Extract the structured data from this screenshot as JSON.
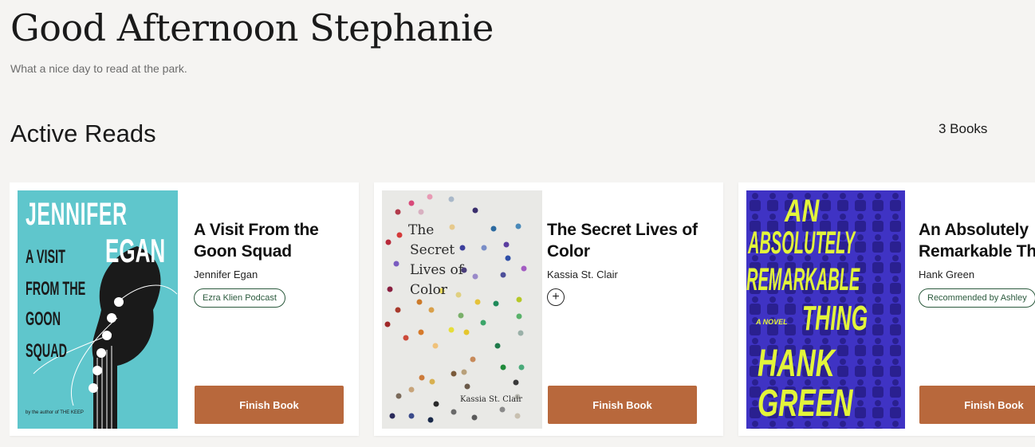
{
  "greeting": "Good Afternoon Stephanie",
  "subtitle": "What a nice day to read at the park.",
  "section": {
    "title": "Active Reads",
    "count": "3 Books"
  },
  "books": [
    {
      "title": "A Visit From the Goon Squad",
      "author": "Jennifer Egan",
      "tag": "Ezra Klien Podcast",
      "action": "Finish Book",
      "cover": {
        "bg": "#5fc6cc",
        "line1": "JENNIFER",
        "line2": "EGAN",
        "t1": "A VISIT",
        "t2": "FROM THE",
        "t3": "GOON",
        "t4": "SQUAD",
        "byline": "by the author of THE KEEP"
      }
    },
    {
      "title": "The Secret Lives of Color",
      "author": "Kassia St. Clair",
      "tag": "",
      "add_icon": "+",
      "action": "Finish Book",
      "cover": {
        "bg": "#e9e9e6",
        "t1": "The",
        "t2": "Secret",
        "t3": "Lives of",
        "t4": "Color",
        "byline": "Kassia St. Clair"
      }
    },
    {
      "title": "An Absolutely Remarkable Thing",
      "author": "Hank Green",
      "tag": "Recommended by Ashley",
      "action": "Finish Book",
      "cover": {
        "bg": "#3f33c4",
        "fg": "#e3f53a",
        "t1": "AN",
        "t2": "ABSOLUTELY",
        "t3": "REMARKABLE",
        "t4": "THING",
        "t5": "HANK",
        "t6": "GREEN",
        "novel": "A NOVEL"
      }
    }
  ],
  "colors": {
    "accent": "#b8683c",
    "tag": "#2b5a3d",
    "background": "#f5f4f2"
  }
}
